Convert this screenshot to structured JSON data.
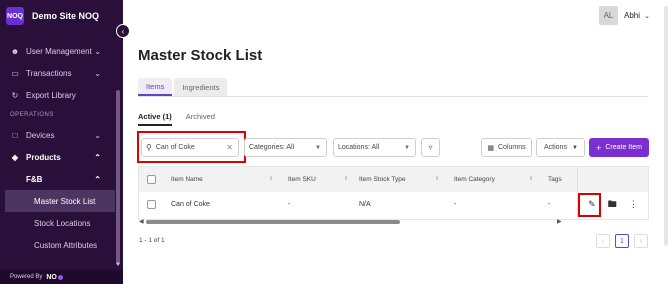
{
  "app": {
    "site_name": "Demo Site NOQ",
    "logo_text": "NOQ"
  },
  "sidebar": {
    "items": [
      {
        "label": "User Management",
        "icon": "person-icon",
        "has_chevron": true
      },
      {
        "label": "Transactions",
        "icon": "card-icon",
        "has_chevron": true
      },
      {
        "label": "Export Library",
        "icon": "refresh-icon",
        "has_chevron": false
      }
    ],
    "section_operations": "OPERATIONS",
    "devices": "Devices",
    "products": "Products",
    "fb": "F&B",
    "sub_items": [
      "Master Stock List",
      "Stock Locations",
      "Custom Attributes"
    ],
    "powered_by": "Powered By",
    "powered_brand": "NO"
  },
  "user": {
    "initials": "AL",
    "name": "Abhi"
  },
  "page": {
    "title": "Master Stock List",
    "tabs": [
      "Items",
      "Ingredients"
    ],
    "subtabs": [
      "Active (1)",
      "Archived"
    ]
  },
  "toolbar": {
    "search_value": "Can of Coke",
    "categories": "Categories: All",
    "locations": "Locations: All",
    "columns": "Columns",
    "actions": "Actions",
    "create": "Create Item"
  },
  "table": {
    "headers": [
      "Item Name",
      "Item SKU",
      "Item Stock Type",
      "Item Category",
      "Tags"
    ],
    "rows": [
      {
        "name": "Can of Coke",
        "sku": "-",
        "stock_type": "N/A",
        "category": "-",
        "tags": "-"
      }
    ]
  },
  "pagination": {
    "info": "1 - 1 of 1",
    "current": "1"
  },
  "colors": {
    "sidebar_bg": "#2a0f3a",
    "accent": "#7a2fd0",
    "highlight": "#dd0000"
  }
}
